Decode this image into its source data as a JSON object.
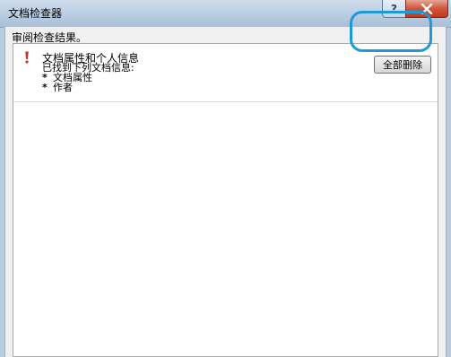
{
  "window": {
    "title": "文档检查器",
    "help_label": "?"
  },
  "dialog": {
    "section_label": "审阅检查结果。",
    "results": [
      {
        "title": "文档属性和个人信息",
        "detail": "已找到下列文档信息:",
        "items": [
          "文档属性",
          "作者"
        ],
        "bullet": "*",
        "action_label": "全部删除",
        "status_icon": "warning-exclamation-icon"
      }
    ]
  },
  "colors": {
    "warning": "#c0392b",
    "highlight": "#1c9ad8",
    "close_button": "#c94a2e"
  }
}
